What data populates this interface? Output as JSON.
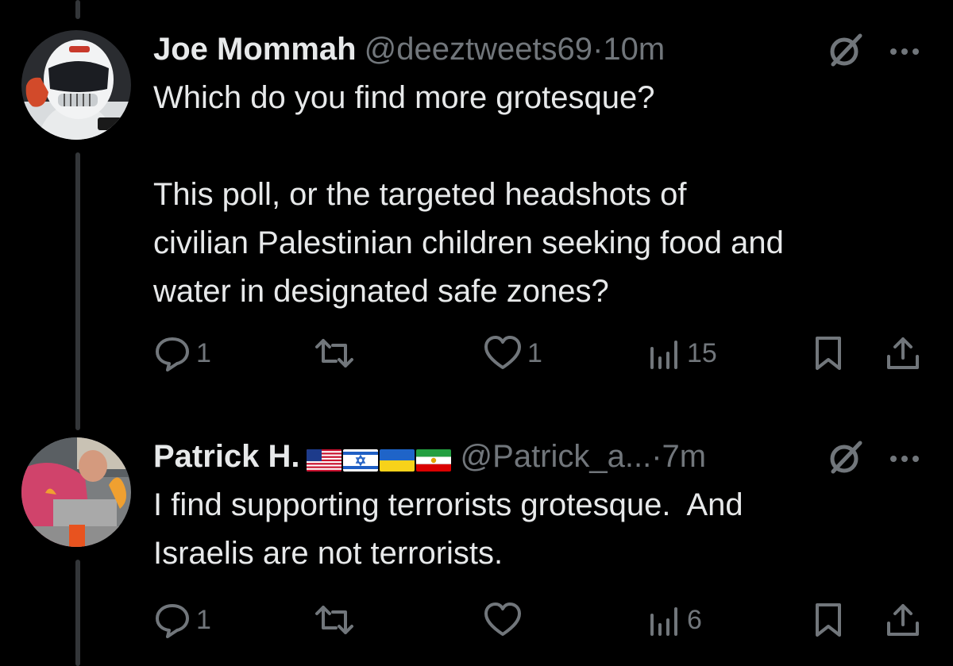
{
  "tweets": [
    {
      "display_name": "Joe Mommah",
      "handle": "@deeztweets69",
      "separator": "·",
      "time": "10m",
      "text": "Which do you find more grotesque?\n\nThis poll, or the targeted headshots of\ncivilian Palestinian children seeking food and\nwater in designated safe zones?",
      "avatar_icon": "racing-helmet-avatar",
      "reply_count": "1",
      "repost_count": "",
      "like_count": "1",
      "view_count": "15"
    },
    {
      "display_name": "Patrick H.",
      "flags": [
        "us-flag",
        "israel-flag",
        "ukraine-flag",
        "iran-lion-sun-flag"
      ],
      "handle": "@Patrick_a...",
      "separator": "·",
      "time": "7m",
      "text": "I find supporting terrorists grotesque.  And\nIsraelis are not terrorists.",
      "avatar_icon": "person-photo-avatar",
      "reply_count": "1",
      "repost_count": "",
      "like_count": "",
      "view_count": "6"
    }
  ],
  "colors": {
    "background": "#000000",
    "primary_text": "#e7e9ea",
    "secondary_text": "#71767b",
    "thread_line": "#333639"
  }
}
